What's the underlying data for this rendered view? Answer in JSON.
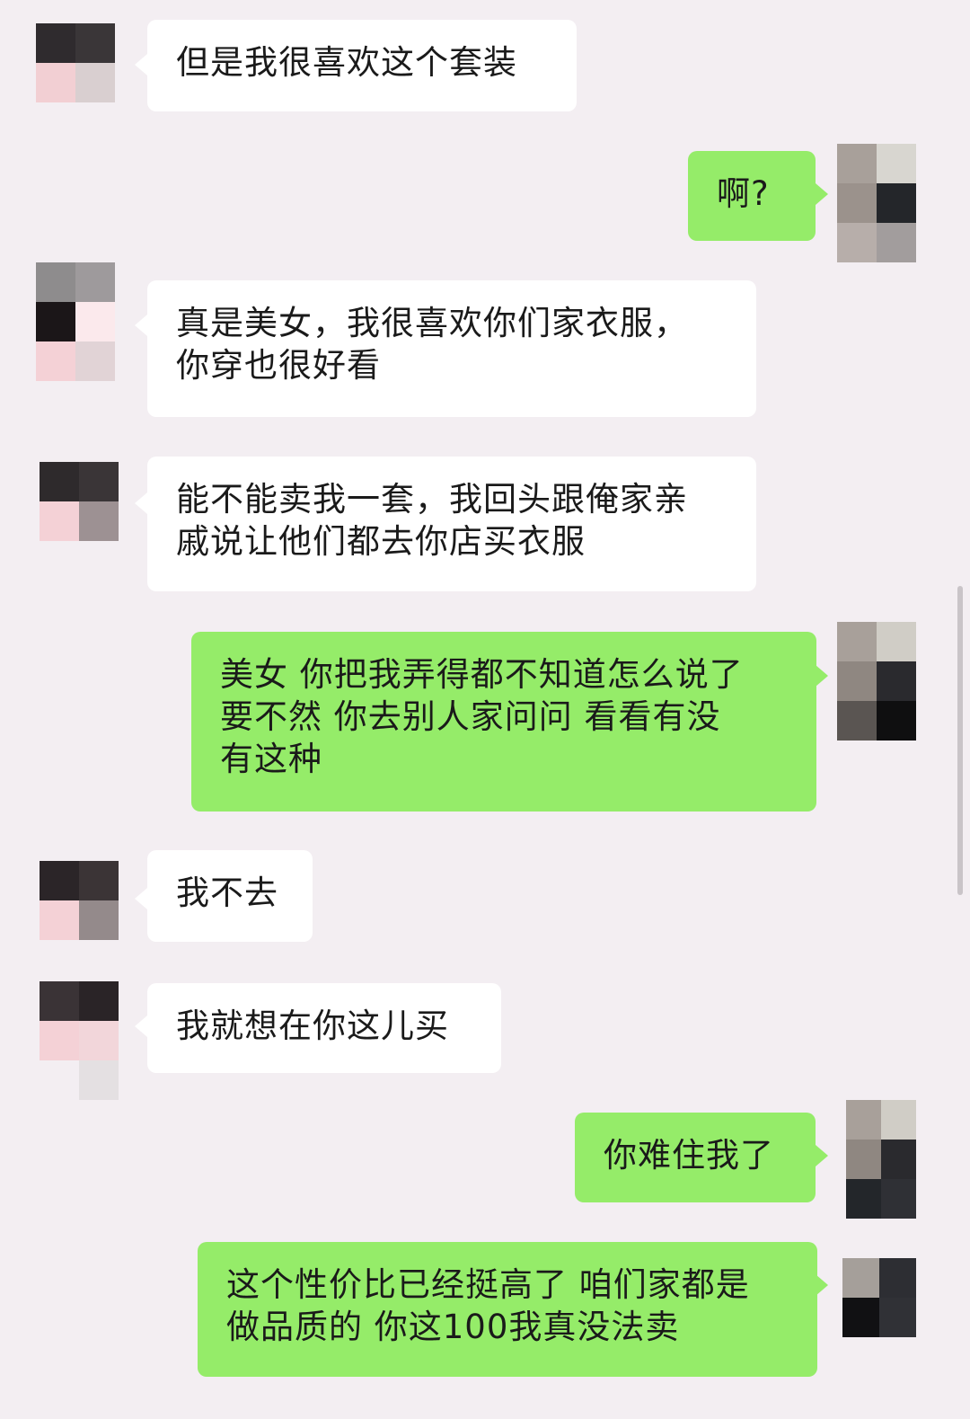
{
  "messages": [
    {
      "side": "left",
      "text": "但是我很喜欢这个套装"
    },
    {
      "side": "right",
      "text": "啊?"
    },
    {
      "side": "left",
      "text": "真是美女，我很喜欢你们家衣服，\n你穿也很好看"
    },
    {
      "side": "left",
      "text": "能不能卖我一套，我回头跟俺家亲\n戚说让他们都去你店买衣服"
    },
    {
      "side": "right",
      "text": "美女 你把我弄得都不知道怎么说了\n要不然 你去别人家问问 看看有没\n有这种"
    },
    {
      "side": "left",
      "text": "我不去"
    },
    {
      "side": "left",
      "text": "我就想在你这儿买"
    },
    {
      "side": "right",
      "text": "你难住我了"
    },
    {
      "side": "right",
      "text": "这个性价比已经挺高了 咱们家都是\n做品质的 你这100我真没法卖"
    }
  ],
  "colors": {
    "background": "#f3eef2",
    "left_bubble": "#ffffff",
    "right_bubble": "#95ec69"
  }
}
